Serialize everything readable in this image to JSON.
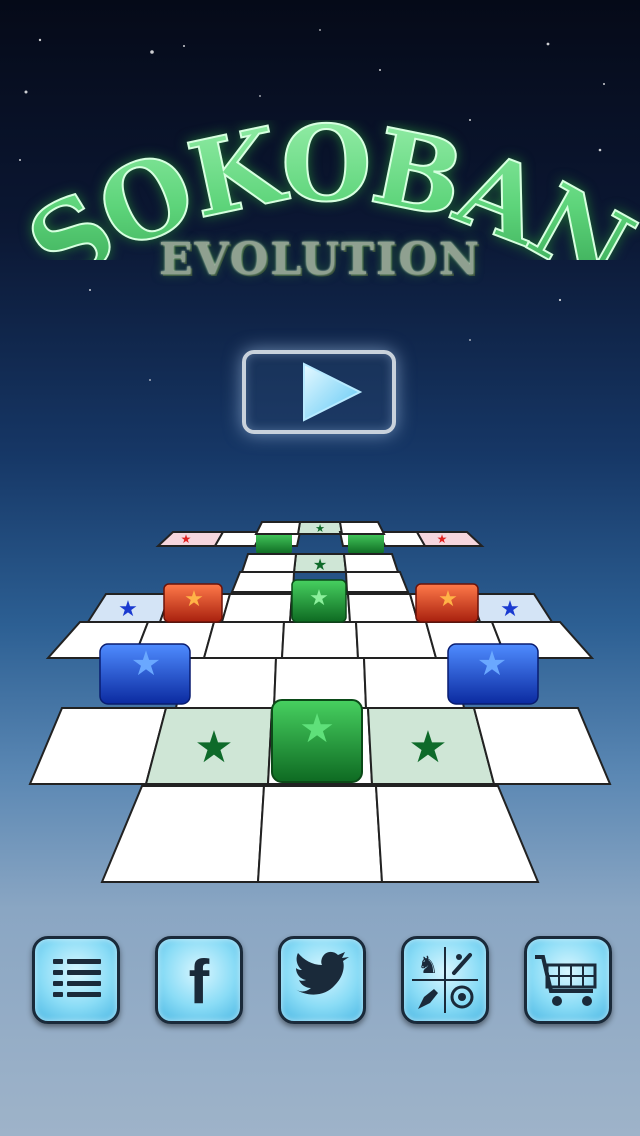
{
  "game": {
    "title": "SOKOBAN",
    "subtitle": "EVOLUTION"
  },
  "colors": {
    "title_green": "#5dd47a",
    "tile_white": "#ffffff",
    "goal_tint": "#cfe6d6",
    "box_green": "#1f9e3a",
    "box_red": "#e23a1c",
    "box_blue": "#1a4fe0"
  },
  "menu": {
    "play_icon": "play-icon",
    "buttons": [
      {
        "name": "levels-list-button",
        "icon": "list-icon"
      },
      {
        "name": "facebook-button",
        "icon": "facebook-icon"
      },
      {
        "name": "twitter-button",
        "icon": "twitter-icon"
      },
      {
        "name": "game-center-button",
        "icon": "game-center-icon"
      },
      {
        "name": "shop-button",
        "icon": "shopping-cart-icon"
      }
    ]
  }
}
